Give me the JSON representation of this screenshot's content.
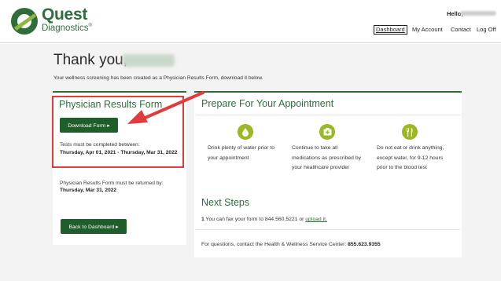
{
  "header": {
    "brand_name": "Quest",
    "brand_sub": "Diagnostics",
    "brand_reg": "®",
    "hello": "Hello,",
    "nav": [
      "Dashboard",
      "My Account",
      "Contact",
      "Log Off"
    ]
  },
  "main": {
    "thank_you": "Thank you,",
    "intro": "Your wellness screening has been created as a Physician Results Form, download it below."
  },
  "left_card": {
    "title": "Physician Results Form",
    "download_button": "Download Form ▸",
    "tests_label": "Tests must be completed between:",
    "tests_dates": "Thursday, Apr 01, 2021 - Thursday, Mar 31, 2022",
    "return_label": "Physician Results Form must be returned by:",
    "return_date": "Thursday, Mar 31, 2022",
    "back_button": "Back to Dashboard ▸"
  },
  "right_card": {
    "title": "Prepare For Your Appointment",
    "tips": [
      {
        "icon": "water-drop-icon",
        "text": "Drink plenty of water prior to your appointment"
      },
      {
        "icon": "medication-icon",
        "text": "Continue to take all medications as prescribed by your healthcare provider"
      },
      {
        "icon": "utensils-icon",
        "text": "Do not eat or drink anything, except water, for 9-12 hours prior to the blood test"
      }
    ],
    "next_steps_title": "Next Steps",
    "next_step_num": "1",
    "next_step_text": "You can fax your form to 844.560.5221 or",
    "next_step_link": "upload it.",
    "contact_text": "For questions, contact the Health & Wellness Service Center:",
    "contact_phone": "855.623.9355"
  },
  "colors": {
    "brand_green": "#2f6e3b",
    "button_green": "#1f5d2a",
    "icon_green": "#9ab726",
    "highlight_red": "#e23b3b"
  }
}
